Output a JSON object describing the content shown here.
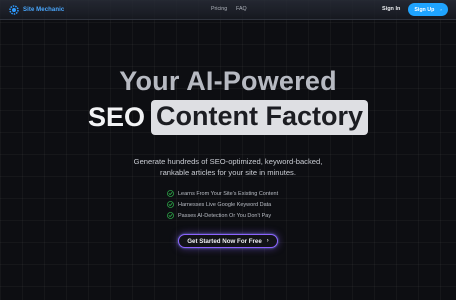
{
  "nav": {
    "brand": "Site Mechanic",
    "links": [
      "Pricing",
      "FAQ"
    ],
    "signin": "Sign In",
    "signup": "Sign Up",
    "signup_icon": "chevron-right-icon"
  },
  "hero": {
    "line1": "Your AI-Powered",
    "line2_plain": "SEO",
    "line2_highlight": "Content Factory",
    "subtitle": "Generate hundreds of SEO-optimized, keyword-backed, rankable articles for your site in minutes.",
    "features": [
      "Learns From Your Site's Existing Content",
      "Harnesses Live Google Keyword Data",
      "Passes AI-Detection Or You Don't Pay"
    ],
    "cta": "Get Started Now For Free"
  },
  "colors": {
    "accent": "#1fa4ff",
    "check": "#2fb24c",
    "cta_glow": "#8d62ff"
  }
}
